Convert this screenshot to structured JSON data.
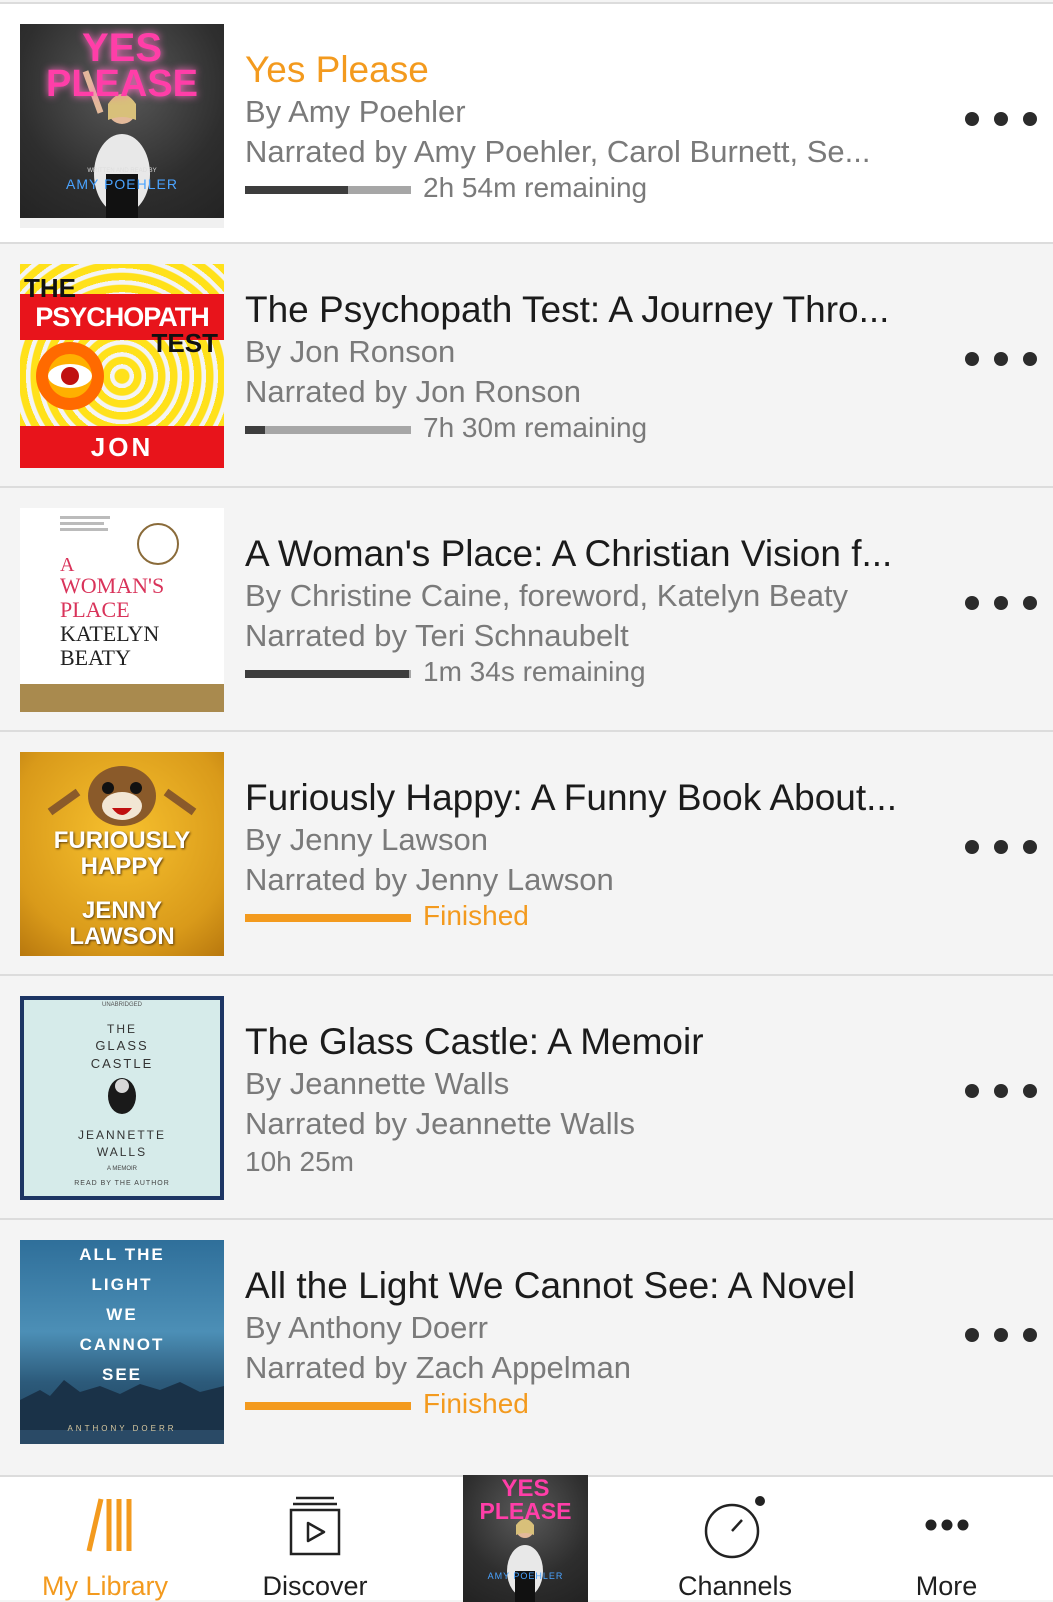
{
  "colors": {
    "accent": "#f39a1e",
    "progress_track": "#a6a6a6",
    "progress_fill": "#3d3d3d",
    "text_primary": "#1b1b1b",
    "text_secondary": "#7a7a7a"
  },
  "library": [
    {
      "title": "Yes Please",
      "author": "By Amy Poehler",
      "narrator": "Narrated by Amy Poehler, Carol Burnett, Se...",
      "status": "progress",
      "progress": 0.62,
      "status_text": "2h 54m remaining",
      "now_playing": true,
      "cover": {
        "line1": "YES",
        "line2": "PLEASE",
        "footer": "AMY POEHLER",
        "small": "WRITTEN AND READ BY"
      }
    },
    {
      "title": "The Psychopath Test: A Journey Thro...",
      "author": "By Jon Ronson",
      "narrator": "Narrated by Jon Ronson",
      "status": "progress",
      "progress": 0.12,
      "status_text": "7h 30m remaining",
      "now_playing": false,
      "cover": {
        "line1": "THE",
        "line2": "PSYCHOPATH",
        "line3": "TEST",
        "footer": "JON RONSON"
      }
    },
    {
      "title": "A Woman's Place: A Christian Vision f...",
      "author": "By Christine Caine, foreword, Katelyn Beaty",
      "narrator": "Narrated by Teri Schnaubelt",
      "status": "progress",
      "progress": 0.99,
      "status_text": "1m 34s remaining",
      "now_playing": false,
      "cover": {
        "line1": "A",
        "line2": "WOMAN'S",
        "line3": "PLACE",
        "line4": "KATELYN",
        "line5": "BEATY"
      }
    },
    {
      "title": "Furiously Happy: A Funny Book About...",
      "author": "By Jenny Lawson",
      "narrator": "Narrated by Jenny Lawson",
      "status": "finished",
      "progress": 1,
      "status_text": "Finished",
      "now_playing": false,
      "cover": {
        "line1": "FURIOUSLY",
        "line2": "HAPPY",
        "line3": "JENNY",
        "line4": "LAWSON"
      }
    },
    {
      "title": "The Glass Castle: A Memoir",
      "author": "By Jeannette Walls",
      "narrator": "Narrated by Jeannette Walls",
      "status": "unstarted",
      "progress": 0,
      "status_text": "10h 25m",
      "now_playing": false,
      "cover": {
        "top": "UNABRIDGED",
        "line1": "THE",
        "line2": "GLASS",
        "line3": "CASTLE",
        "line4": "JEANNETTE",
        "line5": "WALLS",
        "sub": "A MEMOIR",
        "footer": "READ BY THE AUTHOR"
      }
    },
    {
      "title": "All the Light We Cannot See: A Novel",
      "author": "By Anthony Doerr",
      "narrator": "Narrated by Zach Appelman",
      "status": "finished",
      "progress": 1,
      "status_text": "Finished",
      "now_playing": false,
      "cover": {
        "line1": "ALL THE",
        "line2": "LIGHT",
        "line3": "WE",
        "line4": "CANNOT",
        "line5": "SEE",
        "footer": "ANTHONY DOERR"
      }
    }
  ],
  "tabbar": {
    "my_library": {
      "label": "My Library",
      "icon": "library-icon"
    },
    "discover": {
      "label": "Discover",
      "icon": "discover-icon"
    },
    "channels": {
      "label": "Channels",
      "icon": "channels-icon"
    },
    "more": {
      "label": "More",
      "icon": "more-dots-icon"
    },
    "now_playing": {
      "line1": "YES",
      "line2": "PLEASE",
      "footer": "AMY POEHLER"
    }
  }
}
